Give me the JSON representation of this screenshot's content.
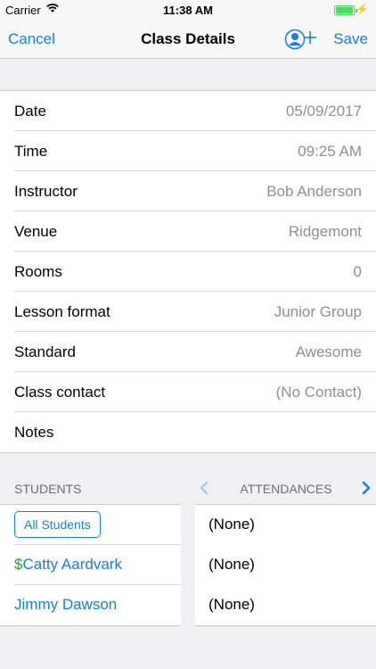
{
  "status_bar": {
    "carrier": "Carrier",
    "time": "11:38 AM",
    "wifi_icon": "wifi-icon",
    "battery_level": 1.0,
    "battery_color": "#4cd964"
  },
  "nav": {
    "cancel": "Cancel",
    "title": "Class Details",
    "add_contact_icon": "add-contact-icon",
    "save": "Save",
    "accent_color": "#1a7ce0"
  },
  "details": [
    {
      "label": "Date",
      "value": "05/09/2017"
    },
    {
      "label": "Time",
      "value": "09:25 AM"
    },
    {
      "label": "Instructor",
      "value": "Bob Anderson"
    },
    {
      "label": "Venue",
      "value": "Ridgemont"
    },
    {
      "label": "Rooms",
      "value": "0"
    },
    {
      "label": "Lesson format",
      "value": "Junior Group"
    },
    {
      "label": "Standard",
      "value": "Awesome"
    },
    {
      "label": "Class contact",
      "value": "(No Contact)"
    },
    {
      "label": "Notes",
      "value": ""
    }
  ],
  "students_section": {
    "header": "STUDENTS",
    "all_students_button": "All Students",
    "students": [
      {
        "prefix": "$",
        "name": "Catty Aardvark"
      },
      {
        "prefix": "",
        "name": "Jimmy Dawson"
      }
    ]
  },
  "attendances_section": {
    "header": "ATTENDANCES",
    "prev_icon": "chevron-left-icon",
    "next_icon": "chevron-right-icon",
    "values": [
      "(None)",
      "(None)",
      "(None)"
    ]
  }
}
